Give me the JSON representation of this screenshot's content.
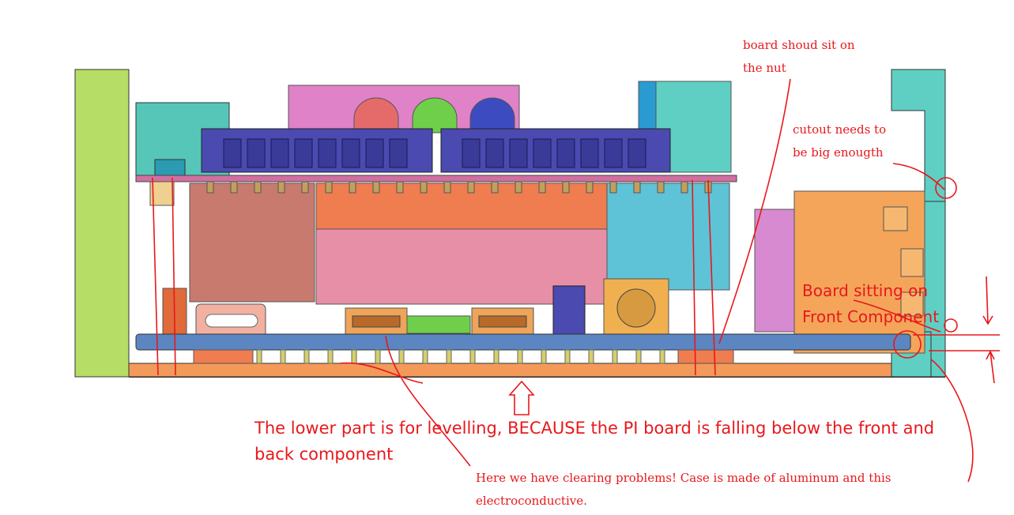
{
  "annotations": {
    "nut": [
      "board shoud sit on",
      "the nut"
    ],
    "cutout": [
      "cutout needs to",
      "be big enougth"
    ],
    "front": [
      "Board sitting on",
      "Front Component"
    ],
    "levelling": [
      "The lower part is for levelling, BECAUSE the PI board is falling below the front and",
      "back component"
    ],
    "clearing": [
      "Here we have clearing problems! Case is made of aluminum and this",
      "electroconductive."
    ]
  },
  "colors": {
    "annotation": "#e8181c",
    "case_left": "#b6dd66",
    "case_right": "#5fcfc4",
    "pcb": "#5b86c2",
    "connector": "#4a4ab0",
    "base_plate": "#f39a5a"
  }
}
